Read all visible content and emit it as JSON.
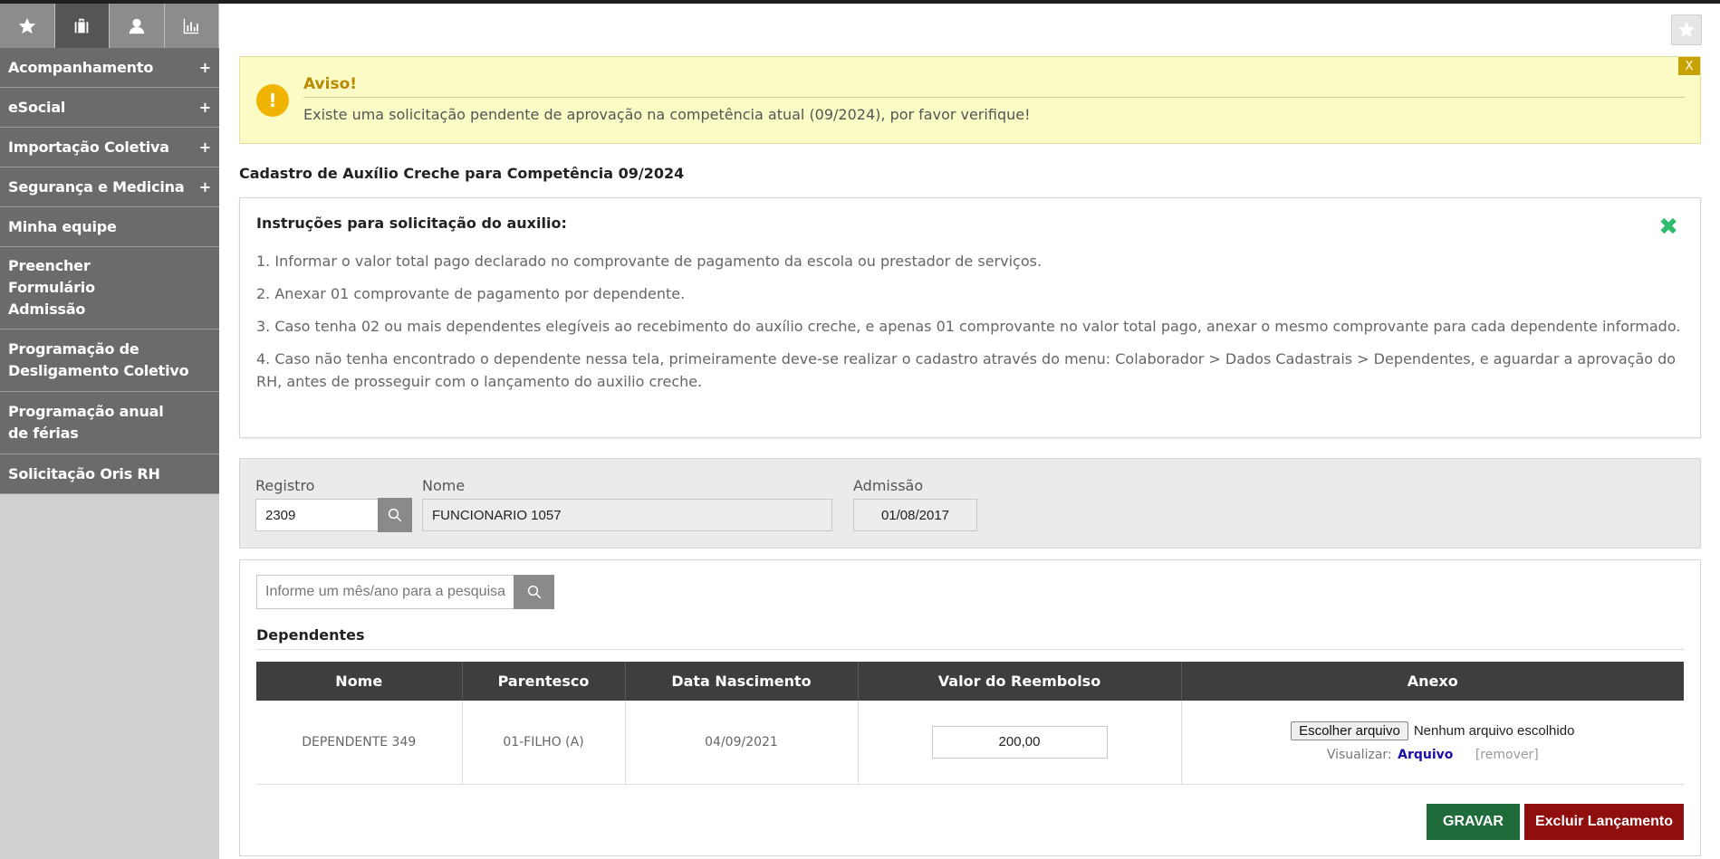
{
  "sidebar": {
    "tabs": [
      {
        "icon": "star-icon"
      },
      {
        "icon": "briefcase-icon"
      },
      {
        "icon": "user-icon"
      },
      {
        "icon": "bar-chart-icon"
      }
    ],
    "items": [
      {
        "label": "Acompanhamento",
        "expand": "+"
      },
      {
        "label": "eSocial",
        "expand": "+"
      },
      {
        "label": "Importação Coletiva",
        "expand": "+"
      },
      {
        "label": "Segurança e Medicina",
        "expand": "+"
      },
      {
        "label": "Minha equipe",
        "expand": ""
      },
      {
        "label": "Preencher Formulário Admissão",
        "expand": ""
      },
      {
        "label": "Programação de Desligamento Coletivo",
        "expand": ""
      },
      {
        "label": "Programação anual de férias",
        "expand": ""
      },
      {
        "label": "Solicitação Oris RH",
        "expand": ""
      }
    ]
  },
  "alert": {
    "icon": "!",
    "title": "Aviso!",
    "text": "Existe uma solicitação pendente de aprovação na competência atual (09/2024), por favor verifique!",
    "close": "X"
  },
  "section_title": "Cadastro de Auxílio Creche para Competência 09/2024",
  "instructions": {
    "title": "Instruções para solicitação do auxilio:",
    "close": "✖",
    "items": [
      "1. Informar o valor total pago declarado no comprovante de pagamento da escola ou prestador de serviços.",
      "2. Anexar 01 comprovante de pagamento por dependente.",
      "3. Caso tenha 02 ou mais dependentes elegíveis ao recebimento do auxílio creche, e apenas 01 comprovante no valor total pago, anexar o mesmo comprovante para cada dependente informado.",
      "4. Caso não tenha encontrado o dependente nessa tela, primeiramente deve-se realizar o cadastro através do menu: Colaborador > Dados Cadastrais > Dependentes, e aguardar a aprovação do RH, antes de prosseguir com o lançamento do auxilio creche."
    ]
  },
  "employee": {
    "registro_label": "Registro",
    "registro_value": "2309",
    "nome_label": "Nome",
    "nome_value": "FUNCIONARIO 1057",
    "admissao_label": "Admissão",
    "admissao_value": "01/08/2017"
  },
  "dependents": {
    "search_placeholder": "Informe um mês/ano para a pesquisa",
    "title": "Dependentes",
    "columns": [
      "Nome",
      "Parentesco",
      "Data Nascimento",
      "Valor do Reembolso",
      "Anexo"
    ],
    "rows": [
      {
        "nome": "DEPENDENTE 349",
        "parentesco": "01-FILHO (A)",
        "nascimento": "04/09/2021",
        "valor": "200,00",
        "file_button": "Escolher arquivo",
        "file_status": "Nenhum arquivo escolhido",
        "view_label": "Visualizar:",
        "view_link": "Arquivo",
        "remove_link": "[remover]"
      }
    ]
  },
  "actions": {
    "save": "GRAVAR",
    "delete": "Excluir Lançamento"
  },
  "colors": {
    "sidebar_item": "#6b6b6b",
    "alert_bg": "#fbfbc5",
    "save": "#1f6b3a",
    "delete": "#8f0f0f",
    "table_header": "#3e3e3e"
  }
}
